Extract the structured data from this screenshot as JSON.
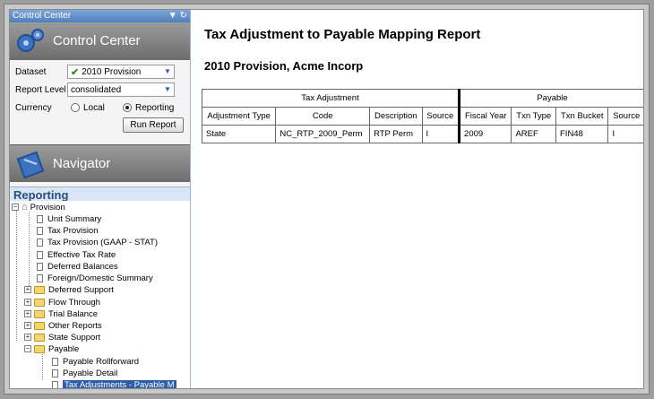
{
  "window": {
    "title": "Control Center"
  },
  "control_center": {
    "banner_title": "Control Center",
    "dataset_label": "Dataset",
    "dataset_value": "2010 Provision",
    "report_level_label": "Report Level",
    "report_level_value": "consolidated",
    "currency_label": "Currency",
    "currency_options": [
      "Local",
      "Reporting"
    ],
    "currency_selected": "Reporting",
    "run_button": "Run Report"
  },
  "navigator": {
    "banner_title": "Navigator",
    "section": "Reporting",
    "tree": {
      "root": "Provision",
      "provision_items": [
        "Unit Summary",
        "Tax Provision",
        "Tax Provision (GAAP - STAT)",
        "Effective Tax Rate",
        "Deferred Balances",
        "Foreign/Domestic Summary"
      ],
      "folders": [
        "Deferred Support",
        "Flow Through",
        "Trial Balance",
        "Other Reports",
        "State Support"
      ],
      "payable_folder": "Payable",
      "payable_items": [
        "Payable Rollforward",
        "Payable Detail",
        "Tax Adjustments - Payable M"
      ],
      "selected": "Tax Adjustments - Payable M"
    }
  },
  "report": {
    "title": "Tax Adjustment to Payable Mapping Report",
    "subtitle": "2010 Provision, Acme Incorp",
    "group_headers": [
      "Tax Adjustment",
      "Payable"
    ],
    "columns": [
      "Adjustment Type",
      "Code",
      "Description",
      "Source",
      "Fiscal Year",
      "Txn Type",
      "Txn Bucket",
      "Source"
    ],
    "rows": [
      [
        "State",
        "NC_RTP_2009_Perm",
        "RTP Perm",
        "I",
        "2009",
        "AREF",
        "FIN48",
        "I"
      ]
    ]
  },
  "colors": {
    "accent": "#2f5ea7",
    "banner": "#7d7d7d",
    "section_header_bg": "#d9e6f5"
  }
}
